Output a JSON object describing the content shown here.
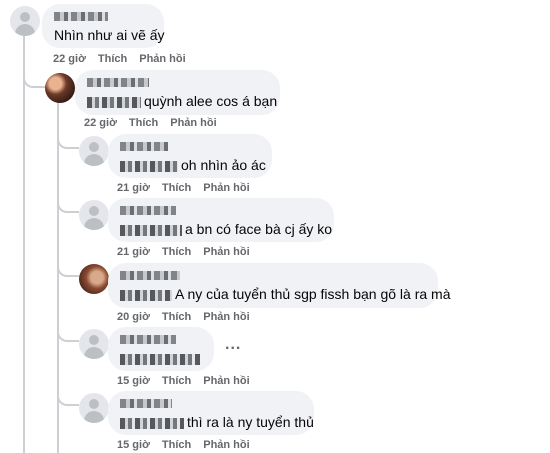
{
  "comments": [
    {
      "text": "Nhìn như ai vẽ ấy",
      "time": "22 giờ",
      "like": "Thích",
      "reply": "Phản hồi"
    },
    {
      "text": "quỳnh alee cos á bạn",
      "time": "22 giờ",
      "like": "Thích",
      "reply": "Phản hồi"
    },
    {
      "text": "oh nhìn ảo ác",
      "time": "21 giờ",
      "like": "Thích",
      "reply": "Phản hồi"
    },
    {
      "text": "a bn có face bà cj ấy ko",
      "time": "21 giờ",
      "like": "Thích",
      "reply": "Phản hồi"
    },
    {
      "text": "A ny của tuyển thủ sgp fissh bạn gõ là ra mà",
      "time": "20 giờ",
      "like": "Thích",
      "reply": "Phản hồi"
    },
    {
      "text": "",
      "time": "15 giờ",
      "like": "Thích",
      "reply": "Phản hồi",
      "more": "..."
    },
    {
      "text": "thì ra là ny tuyển thủ",
      "time": "15 giờ",
      "like": "Thích",
      "reply": "Phản hồi"
    }
  ]
}
